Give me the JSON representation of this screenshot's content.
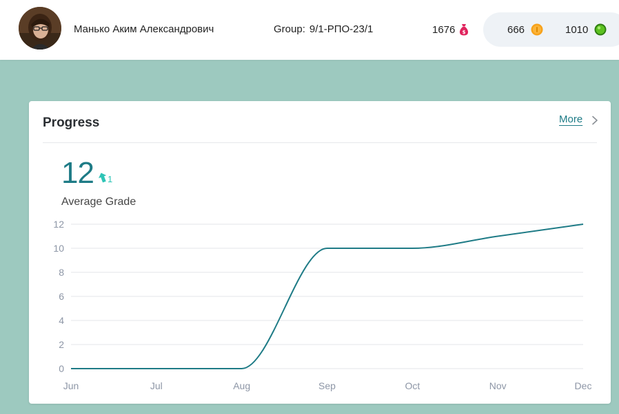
{
  "header": {
    "user_name": "Манько Аким Александрович",
    "group_label": "Group:",
    "group_value": "9/1-РПО-23/1",
    "points": "1676",
    "coins": "666",
    "gems": "1010"
  },
  "card": {
    "title": "Progress",
    "more_label": "More",
    "average_value": "12",
    "trend_delta": "1",
    "metric_label": "Average Grade"
  },
  "colors": {
    "background": "#9dc9bf",
    "accent": "#1e7b86",
    "trend": "#2ec4b6",
    "points_icon": "#e0245e",
    "coin_icon": "#f7a21b",
    "gem_icon": "#5cc120"
  },
  "icons": {
    "points": "money-bag-icon",
    "coins": "coin-icon",
    "gems": "gem-icon",
    "more": "chevron-right-icon",
    "trend": "arrow-up-icon"
  },
  "chart_data": {
    "type": "line",
    "categories": [
      "Jun",
      "Jul",
      "Aug",
      "Sep",
      "Oct",
      "Nov",
      "Dec"
    ],
    "series": [
      {
        "values": [
          0,
          0,
          0,
          10,
          10,
          11,
          12
        ]
      }
    ],
    "yticks": [
      0,
      2,
      4,
      6,
      8,
      10,
      12
    ],
    "ylim": [
      0,
      12
    ],
    "grid": true,
    "smooth": true,
    "title": "",
    "xlabel": "",
    "ylabel": ""
  }
}
